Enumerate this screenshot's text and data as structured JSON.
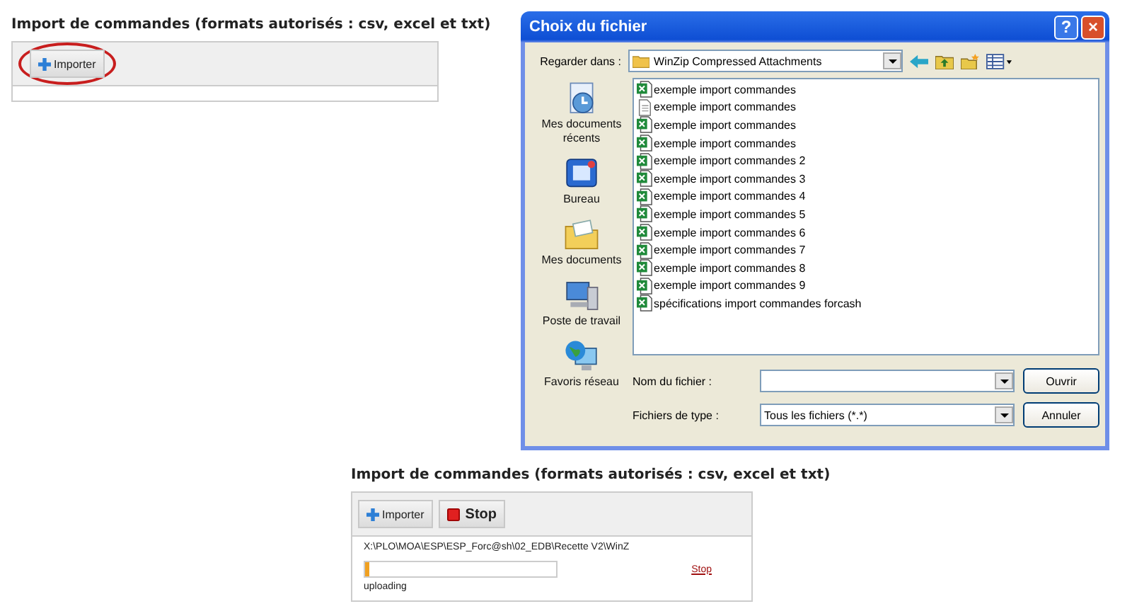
{
  "import_panel": {
    "title": "Import de commandes (formats autorisés : csv, excel et txt)",
    "import_button": "Importer",
    "highlighted": true
  },
  "dialog": {
    "title": "Choix du fichier",
    "help_button": "?",
    "close_button": "×",
    "look_in_label": "Regarder dans :",
    "look_in_value": "WinZip Compressed Attachments",
    "places": [
      {
        "label": "Mes documents récents"
      },
      {
        "label": "Bureau"
      },
      {
        "label": "Mes documents"
      },
      {
        "label": "Poste de travail"
      },
      {
        "label": "Favoris réseau"
      }
    ],
    "files": [
      {
        "name": "exemple import commandes",
        "kind": "excel"
      },
      {
        "name": "exemple import commandes",
        "kind": "text"
      },
      {
        "name": "exemple import commandes",
        "kind": "excel"
      },
      {
        "name": "exemple import commandes",
        "kind": "excel"
      },
      {
        "name": "exemple import commandes 2",
        "kind": "excel"
      },
      {
        "name": "exemple import commandes 3",
        "kind": "excel"
      },
      {
        "name": "exemple import commandes 4",
        "kind": "excel"
      },
      {
        "name": "exemple import commandes 5",
        "kind": "excel"
      },
      {
        "name": "exemple import commandes 6",
        "kind": "excel"
      },
      {
        "name": "exemple import commandes 7",
        "kind": "excel"
      },
      {
        "name": "exemple import commandes 8",
        "kind": "excel"
      },
      {
        "name": "exemple import commandes 9",
        "kind": "excel"
      },
      {
        "name": "spécifications import commandes forcash",
        "kind": "excel"
      }
    ],
    "filename_label": "Nom du fichier :",
    "filetype_label": "Fichiers de type :",
    "filetype_value": "Tous les fichiers (*.*)",
    "open_button": "Ouvrir",
    "cancel_button": "Annuler"
  },
  "upload_panel": {
    "title": "Import de commandes (formats autorisés : csv, excel et txt)",
    "import_button": "Importer",
    "stop_button": "Stop",
    "path": "X:\\PLO\\MOA\\ESP\\ESP_Forc@sh\\02_EDB\\Recette V2\\WinZ",
    "level": 0.02,
    "stop_link": "Stop",
    "status": "uploading"
  }
}
